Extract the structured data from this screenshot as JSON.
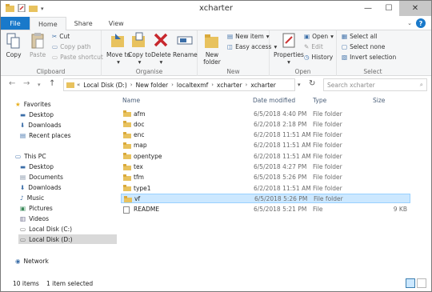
{
  "window": {
    "title": "xcharter"
  },
  "tabs": [
    {
      "label": "File"
    },
    {
      "label": "Home"
    },
    {
      "label": "Share"
    },
    {
      "label": "View"
    }
  ],
  "ribbon": {
    "clipboard": {
      "copy": "Copy",
      "paste": "Paste",
      "cut": "Cut",
      "copy_path": "Copy path",
      "paste_shortcut": "Paste shortcut",
      "label": "Clipboard"
    },
    "organise": {
      "move_to": "Move to",
      "copy_to": "Copy to",
      "delete": "Delete",
      "rename": "Rename",
      "label": "Organise"
    },
    "new": {
      "new_folder": "New folder",
      "new_item": "New item",
      "easy_access": "Easy access",
      "label": "New"
    },
    "open": {
      "properties": "Properties",
      "open": "Open",
      "edit": "Edit",
      "history": "History",
      "label": "Open"
    },
    "select": {
      "select_all": "Select all",
      "select_none": "Select none",
      "invert": "Invert selection",
      "label": "Select"
    }
  },
  "address": {
    "crumbs": [
      "Local Disk (D:)",
      "New folder",
      "localtexmf",
      "xcharter",
      "xcharter"
    ],
    "search_placeholder": "Search xcharter"
  },
  "nav": {
    "favorites": "Favorites",
    "fav_items": [
      "Desktop",
      "Downloads",
      "Recent places"
    ],
    "this_pc": "This PC",
    "pc_items": [
      "Desktop",
      "Documents",
      "Downloads",
      "Music",
      "Pictures",
      "Videos",
      "Local Disk (C:)",
      "Local Disk (D:)"
    ],
    "network": "Network"
  },
  "columns": {
    "name": "Name",
    "date": "Date modified",
    "type": "Type",
    "size": "Size"
  },
  "files": [
    {
      "name": "afm",
      "date": "6/5/2018 4:40 PM",
      "type": "File folder",
      "size": ""
    },
    {
      "name": "doc",
      "date": "6/2/2018 2:18 PM",
      "type": "File folder",
      "size": ""
    },
    {
      "name": "enc",
      "date": "6/2/2018 11:51 AM",
      "type": "File folder",
      "size": ""
    },
    {
      "name": "map",
      "date": "6/2/2018 11:51 AM",
      "type": "File folder",
      "size": ""
    },
    {
      "name": "opentype",
      "date": "6/2/2018 11:51 AM",
      "type": "File folder",
      "size": ""
    },
    {
      "name": "tex",
      "date": "6/5/2018 4:27 PM",
      "type": "File folder",
      "size": ""
    },
    {
      "name": "tfm",
      "date": "6/5/2018 5:26 PM",
      "type": "File folder",
      "size": ""
    },
    {
      "name": "type1",
      "date": "6/2/2018 11:51 AM",
      "type": "File folder",
      "size": ""
    },
    {
      "name": "vf",
      "date": "6/5/2018 5:26 PM",
      "type": "File folder",
      "size": ""
    },
    {
      "name": "README",
      "date": "6/5/2018 5:21 PM",
      "type": "File",
      "size": "9 KB"
    }
  ],
  "selected_index": 8,
  "status": {
    "count": "10 items",
    "selection": "1 item selected"
  },
  "colors": {
    "accent": "#1979ca",
    "selection": "#cce8ff",
    "folder": "#e8c25e"
  }
}
